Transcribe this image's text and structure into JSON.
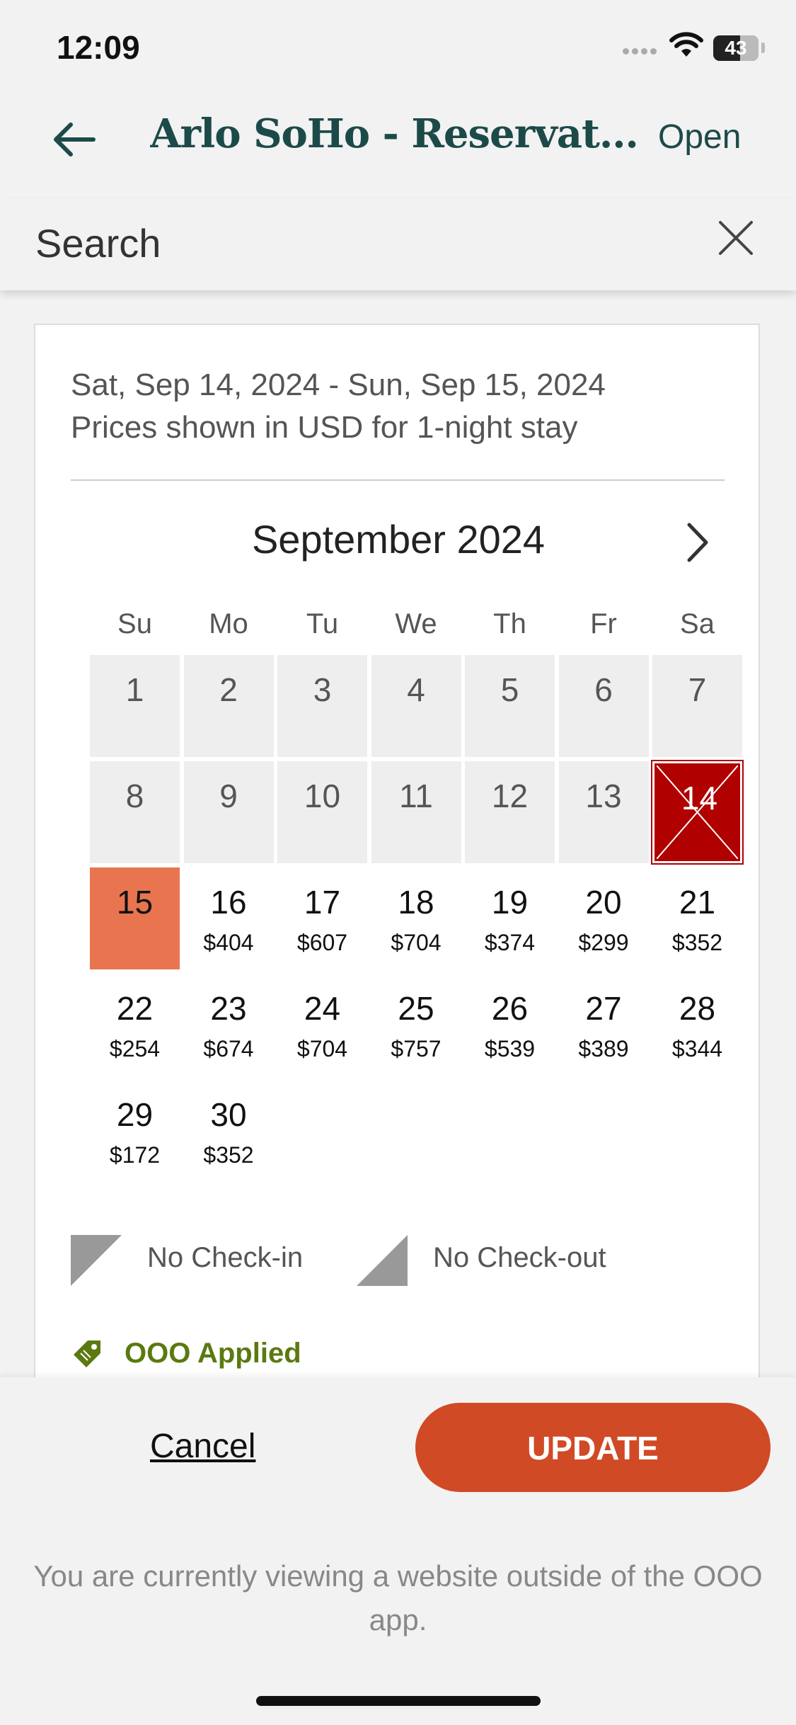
{
  "status_bar": {
    "time": "12:09",
    "battery": "43"
  },
  "header": {
    "title": "Arlo SoHo - Reservatio…",
    "open_label": "Open"
  },
  "search": {
    "placeholder": "Search",
    "value": "Search"
  },
  "card": {
    "date_range": "Sat, Sep 14, 2024 - Sun, Sep 15, 2024",
    "price_note": "Prices shown in USD for 1-night stay",
    "month_label": "September 2024"
  },
  "weekdays": [
    "Su",
    "Mo",
    "Tu",
    "We",
    "Th",
    "Fr",
    "Sa"
  ],
  "days": [
    {
      "day": "1",
      "price": "",
      "state": "past"
    },
    {
      "day": "2",
      "price": "",
      "state": "past"
    },
    {
      "day": "3",
      "price": "",
      "state": "past"
    },
    {
      "day": "4",
      "price": "",
      "state": "past"
    },
    {
      "day": "5",
      "price": "",
      "state": "past"
    },
    {
      "day": "6",
      "price": "",
      "state": "past"
    },
    {
      "day": "7",
      "price": "",
      "state": "past"
    },
    {
      "day": "8",
      "price": "",
      "state": "past"
    },
    {
      "day": "9",
      "price": "",
      "state": "past"
    },
    {
      "day": "10",
      "price": "",
      "state": "past"
    },
    {
      "day": "11",
      "price": "",
      "state": "past"
    },
    {
      "day": "12",
      "price": "",
      "state": "past"
    },
    {
      "day": "13",
      "price": "",
      "state": "past"
    },
    {
      "day": "14",
      "price": "",
      "state": "checkin"
    },
    {
      "day": "15",
      "price": "",
      "state": "checkout"
    },
    {
      "day": "16",
      "price": "$404",
      "state": "available"
    },
    {
      "day": "17",
      "price": "$607",
      "state": "available"
    },
    {
      "day": "18",
      "price": "$704",
      "state": "available"
    },
    {
      "day": "19",
      "price": "$374",
      "state": "available"
    },
    {
      "day": "20",
      "price": "$299",
      "state": "available"
    },
    {
      "day": "21",
      "price": "$352",
      "state": "available"
    },
    {
      "day": "22",
      "price": "$254",
      "state": "available"
    },
    {
      "day": "23",
      "price": "$674",
      "state": "available"
    },
    {
      "day": "24",
      "price": "$704",
      "state": "available"
    },
    {
      "day": "25",
      "price": "$757",
      "state": "available"
    },
    {
      "day": "26",
      "price": "$539",
      "state": "available"
    },
    {
      "day": "27",
      "price": "$389",
      "state": "available"
    },
    {
      "day": "28",
      "price": "$344",
      "state": "available"
    },
    {
      "day": "29",
      "price": "$172",
      "state": "available"
    },
    {
      "day": "30",
      "price": "$352",
      "state": "available"
    }
  ],
  "legend": {
    "no_checkin": "No Check-in",
    "no_checkout": "No Check-out"
  },
  "promo": {
    "label": "OOO Applied"
  },
  "actions": {
    "cancel_label": "Cancel",
    "update_label": "UPDATE"
  },
  "notice": "You are currently viewing a website outside of the OOO app.",
  "colors": {
    "brand_teal": "#1c4a49",
    "update_button": "#d04a26",
    "checkin_selected": "#b00000",
    "checkout_selected": "#e8754f",
    "promo_green": "#5a7a10"
  },
  "icons": {
    "back": "arrow-left-icon",
    "close": "close-icon",
    "next_month": "chevron-right-icon",
    "promo": "tag-icon",
    "wifi": "wifi-icon"
  }
}
